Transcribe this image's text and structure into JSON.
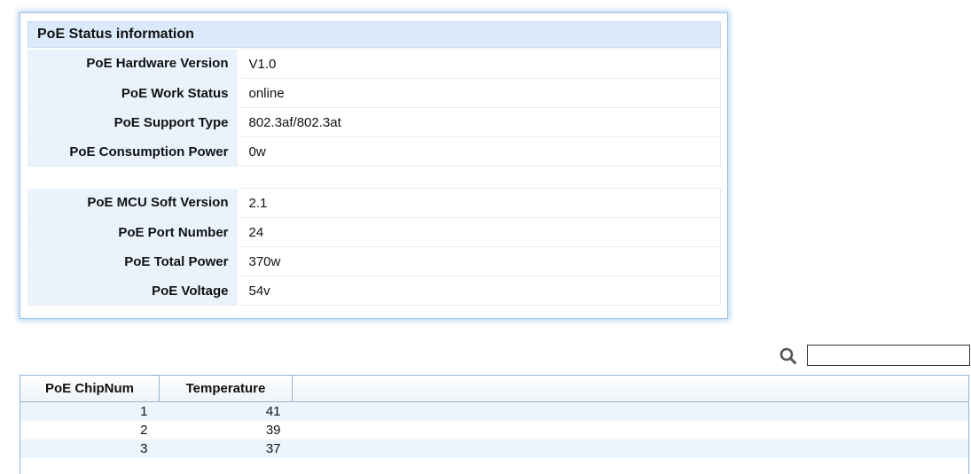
{
  "status_panel": {
    "title": "PoE Status information",
    "group1": [
      {
        "label": "PoE Hardware Version",
        "value": "V1.0"
      },
      {
        "label": "PoE Work Status",
        "value": "online"
      },
      {
        "label": "PoE Support Type",
        "value": "802.3af/802.3at"
      },
      {
        "label": "PoE Consumption Power",
        "value": "0w"
      }
    ],
    "group2": [
      {
        "label": "PoE MCU Soft Version",
        "value": "2.1"
      },
      {
        "label": "PoE Port Number",
        "value": "24"
      },
      {
        "label": "PoE Total Power",
        "value": "370w"
      },
      {
        "label": "PoE Voltage",
        "value": "54v"
      }
    ]
  },
  "search": {
    "icon": "search-icon",
    "value": ""
  },
  "temperature_table": {
    "columns": [
      "PoE ChipNum",
      "Temperature"
    ],
    "rows": [
      {
        "chip": "1",
        "temperature": "41"
      },
      {
        "chip": "2",
        "temperature": "39"
      },
      {
        "chip": "3",
        "temperature": "37"
      }
    ]
  }
}
